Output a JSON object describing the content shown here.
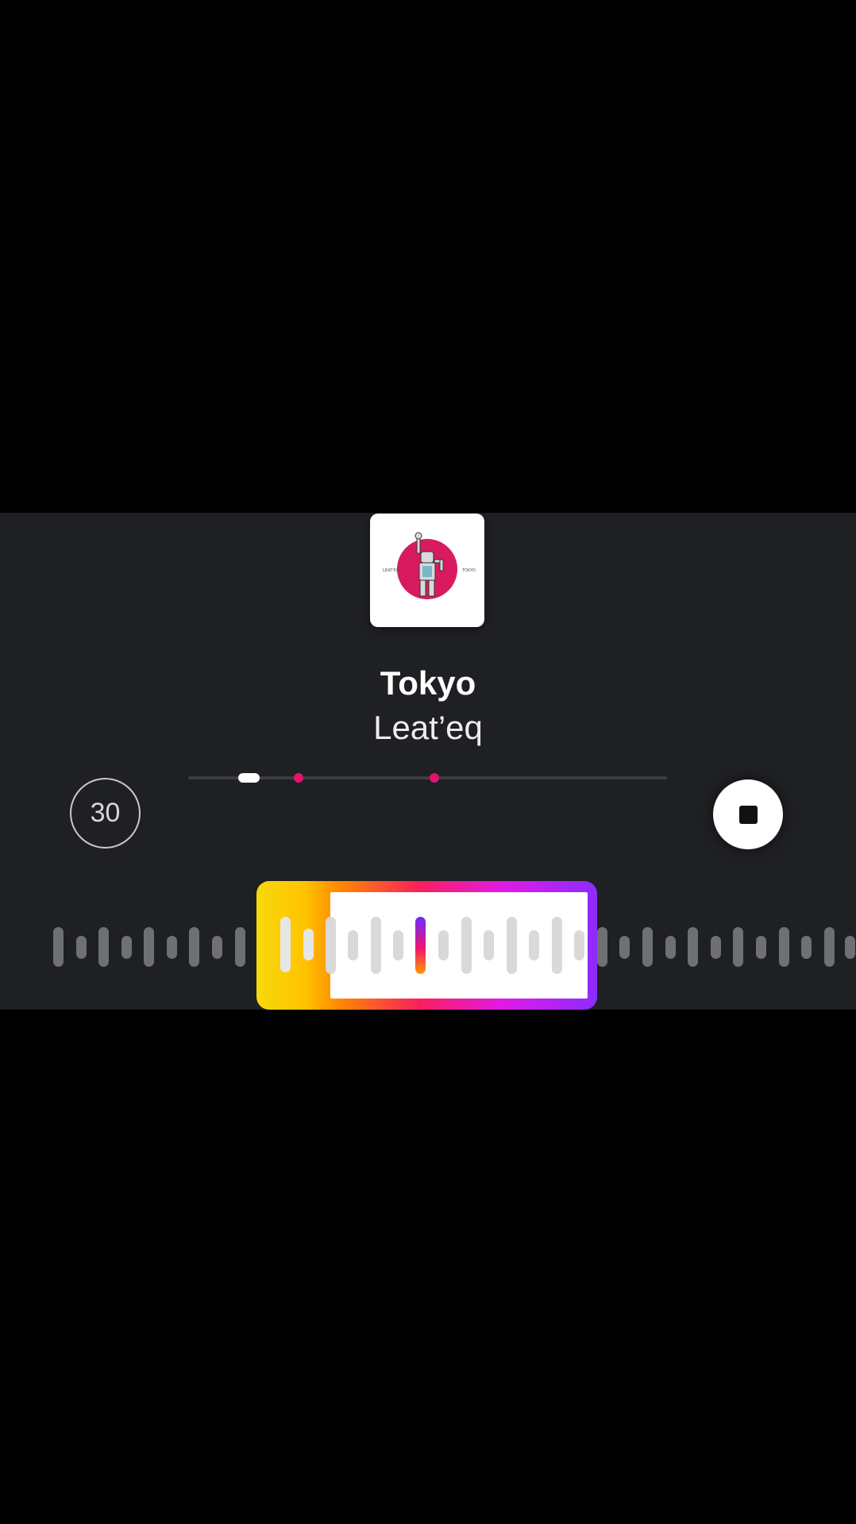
{
  "song": {
    "title": "Tokyo",
    "artist": "Leat’eq",
    "cover_icon": "album-art-robot-on-pink-circle"
  },
  "controls": {
    "duration_label": "30",
    "stop_icon": "stop-icon"
  },
  "colors": {
    "panel_bg": "#1f2023",
    "marker": "#e1136f",
    "gradient": [
      "#f7d90c",
      "#ff8a00",
      "#f91f5e",
      "#e11ae6",
      "#8c2cff"
    ]
  },
  "timeline": {
    "playhead_progress": 0.12,
    "markers": [
      0.23,
      0.52
    ]
  }
}
